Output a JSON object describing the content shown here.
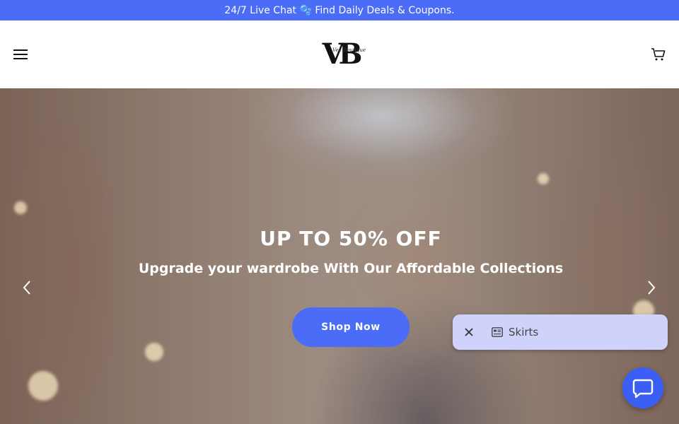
{
  "announcement": {
    "text": "24/7 Live Chat 🫧 Find Daily Deals & Coupons."
  },
  "header": {
    "menu_icon": "hamburger-menu-icon",
    "logo_text": "VB",
    "logo_script": "Vee Boutique",
    "cart_icon": "cart-icon"
  },
  "hero": {
    "title": "UP TO 50% OFF",
    "subtitle": "Upgrade your wardrobe With Our Affordable Collections",
    "cta_label": "Shop Now",
    "prev_icon": "chevron-left-icon",
    "next_icon": "chevron-right-icon"
  },
  "suggestion": {
    "close_icon": "close-icon",
    "item_icon": "list-card-icon",
    "label": "Skirts"
  },
  "chat": {
    "icon": "chat-bubble-icon"
  },
  "colors": {
    "accent": "#4a6cf7",
    "suggestion_bg": "#cfd3fb"
  }
}
